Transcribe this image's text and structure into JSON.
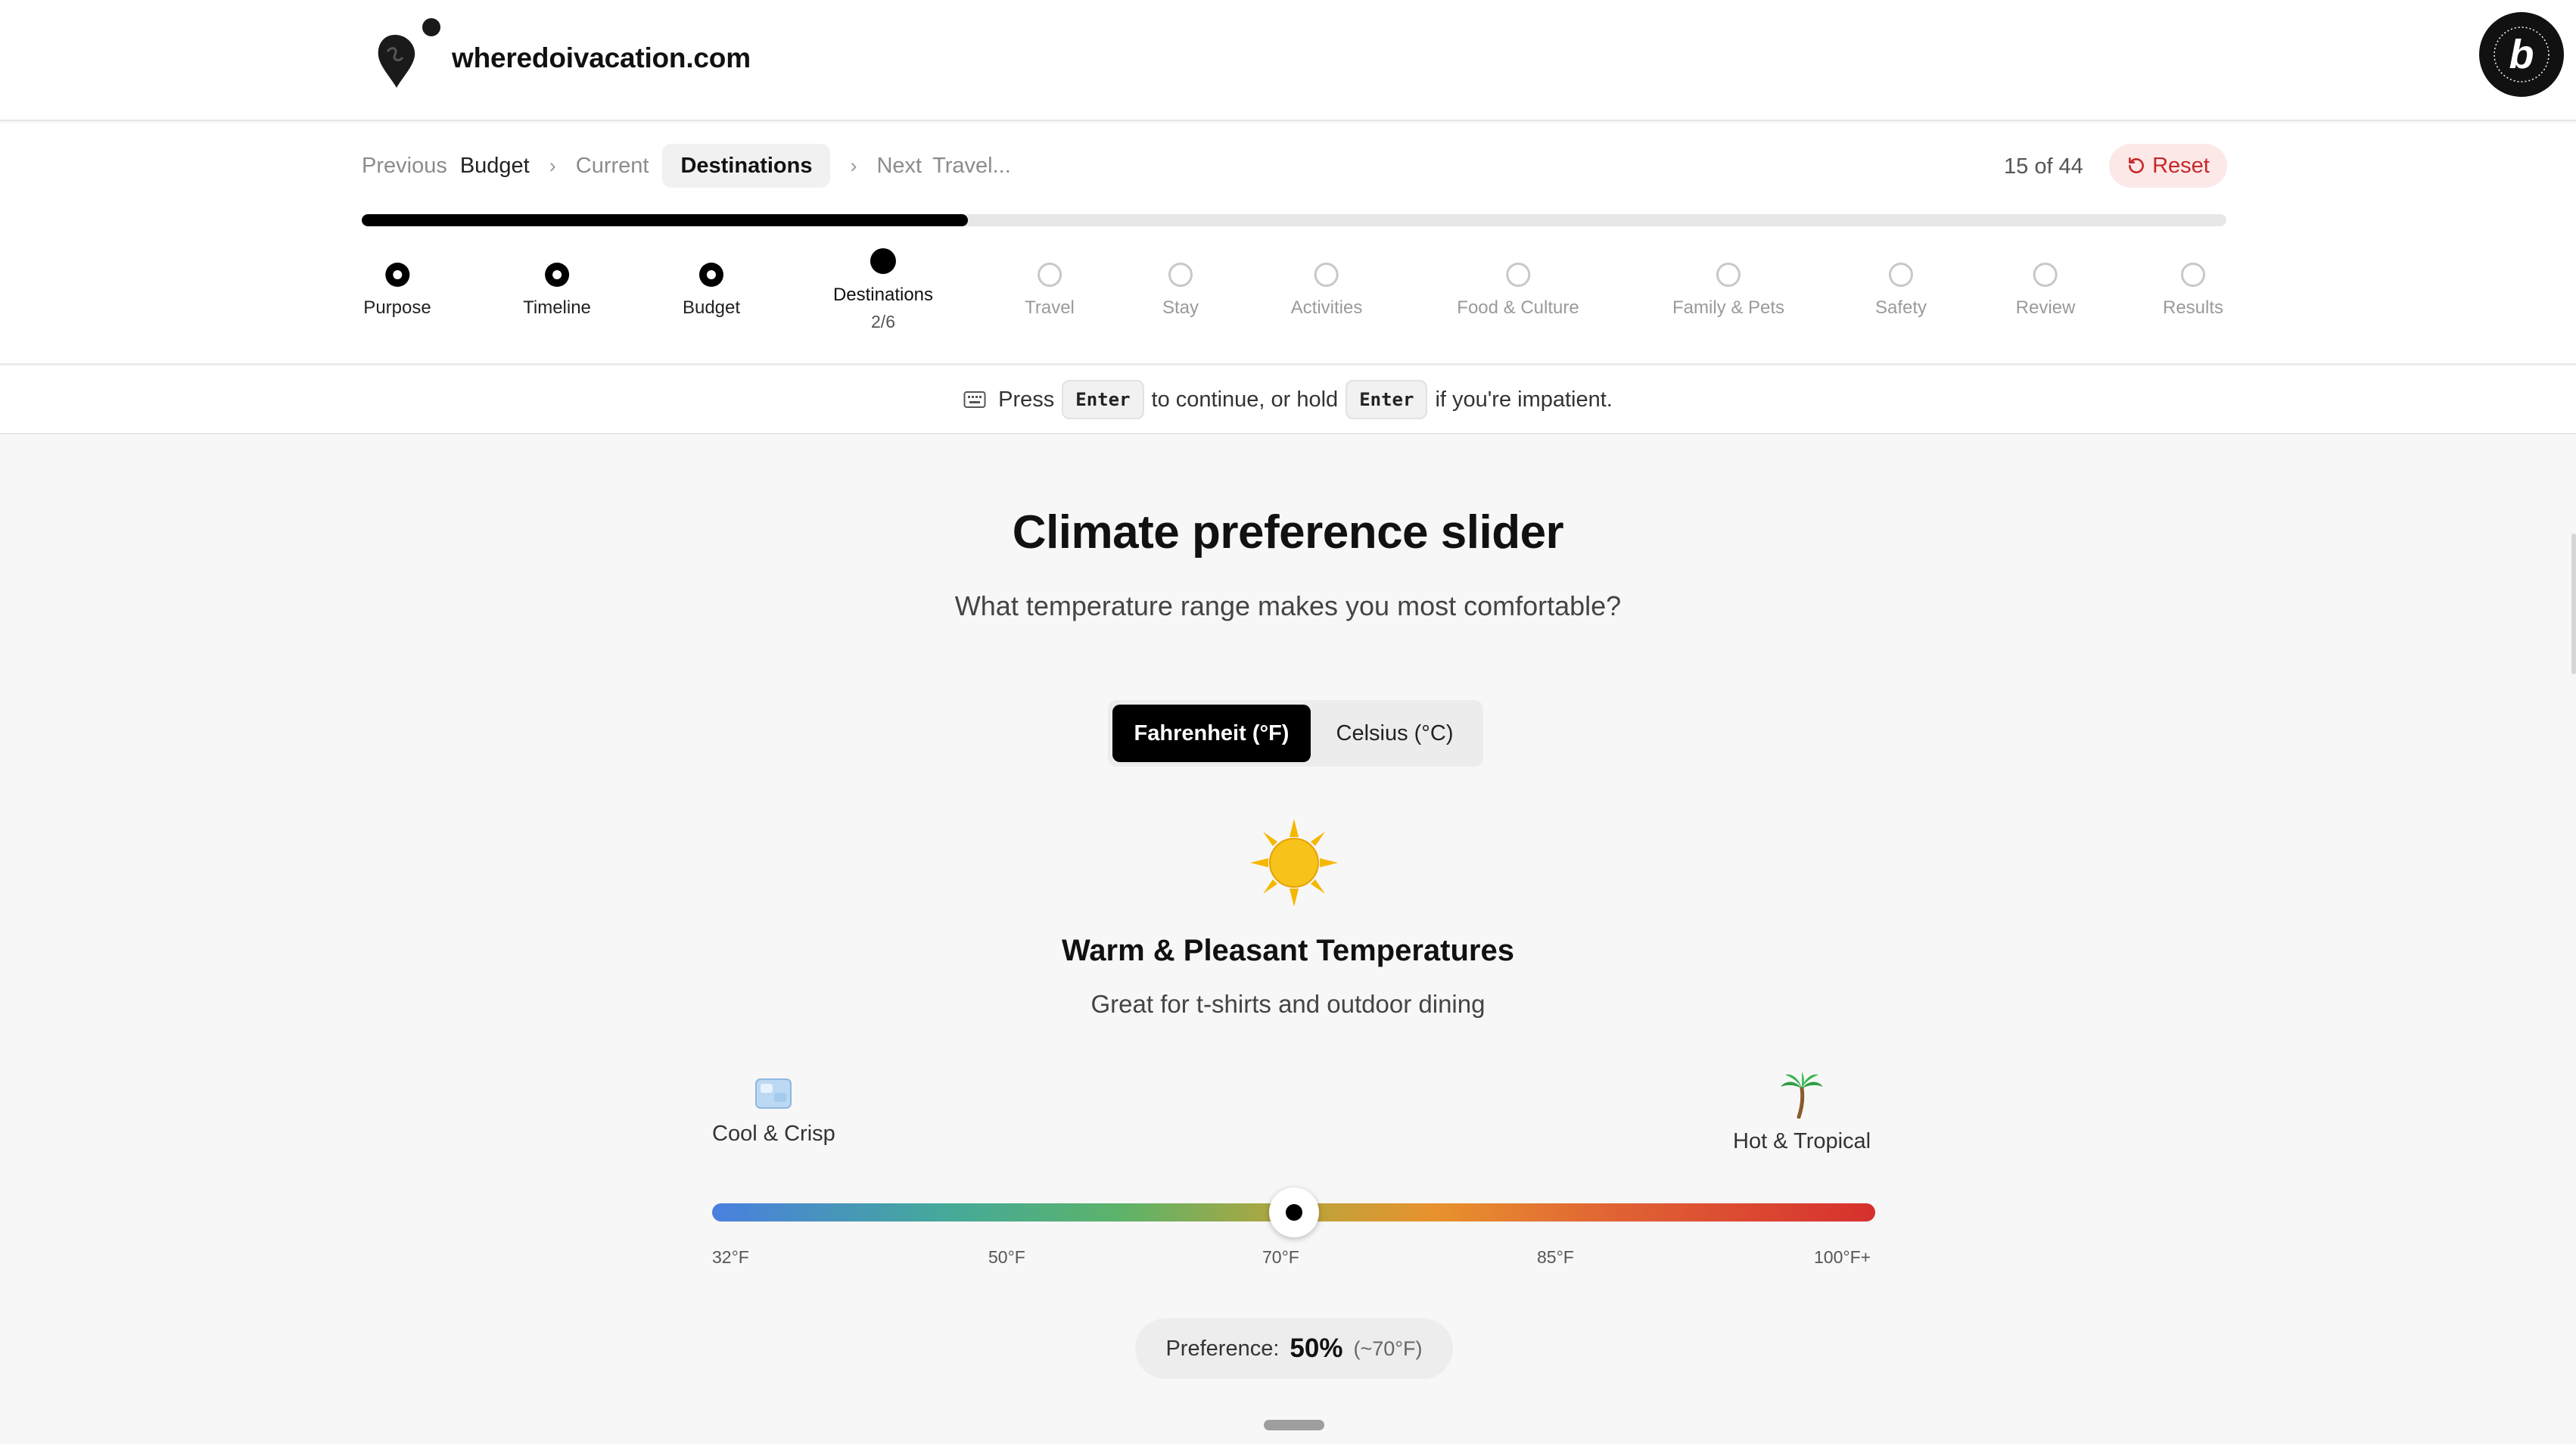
{
  "site": {
    "name": "wheredoivacation.com",
    "badge": "POWERED BY BOLT · MADE IN BOLT · NEW"
  },
  "breadcrumb": {
    "previous_label": "Previous",
    "previous_value": "Budget",
    "current_label": "Current",
    "current_value": "Destinations",
    "next_label": "Next",
    "next_value": "Travel..."
  },
  "progress": {
    "counter": "15 of 44",
    "fraction": 0.325
  },
  "reset_label": "Reset",
  "steps": [
    {
      "label": "Purpose",
      "state": "done"
    },
    {
      "label": "Timeline",
      "state": "done"
    },
    {
      "label": "Budget",
      "state": "done"
    },
    {
      "label": "Destinations",
      "state": "current",
      "sub": "2/6"
    },
    {
      "label": "Travel",
      "state": "todo"
    },
    {
      "label": "Stay",
      "state": "todo"
    },
    {
      "label": "Activities",
      "state": "todo"
    },
    {
      "label": "Food & Culture",
      "state": "todo"
    },
    {
      "label": "Family & Pets",
      "state": "todo"
    },
    {
      "label": "Safety",
      "state": "todo"
    },
    {
      "label": "Review",
      "state": "todo"
    },
    {
      "label": "Results",
      "state": "todo"
    }
  ],
  "hint": {
    "press": "Press",
    "key1": "Enter",
    "middle": "to continue, or hold",
    "key2": "Enter",
    "end": "if you're impatient."
  },
  "question": {
    "title": "Climate preference slider",
    "subtitle": "What temperature range makes you most comfortable?"
  },
  "units": {
    "fahrenheit": "Fahrenheit (°F)",
    "celsius": "Celsius (°C)",
    "selected": "fahrenheit"
  },
  "result": {
    "icon": "sun-icon",
    "title": "Warm & Pleasant Temperatures",
    "description": "Great for t-shirts and outdoor dining"
  },
  "slider": {
    "min_label": "Cool & Crisp",
    "min_icon": "ice-cube-icon",
    "max_label": "Hot & Tropical",
    "max_icon": "palm-tree-icon",
    "value_fraction": 0.5,
    "ticks": [
      "32°F",
      "50°F",
      "70°F",
      "85°F",
      "100°F+"
    ]
  },
  "preference": {
    "label": "Preference:",
    "value": "50%",
    "note": "(~70°F)"
  },
  "colors": {
    "accent": "#000000",
    "reset_bg": "#fde8e8",
    "reset_text": "#c62828"
  }
}
